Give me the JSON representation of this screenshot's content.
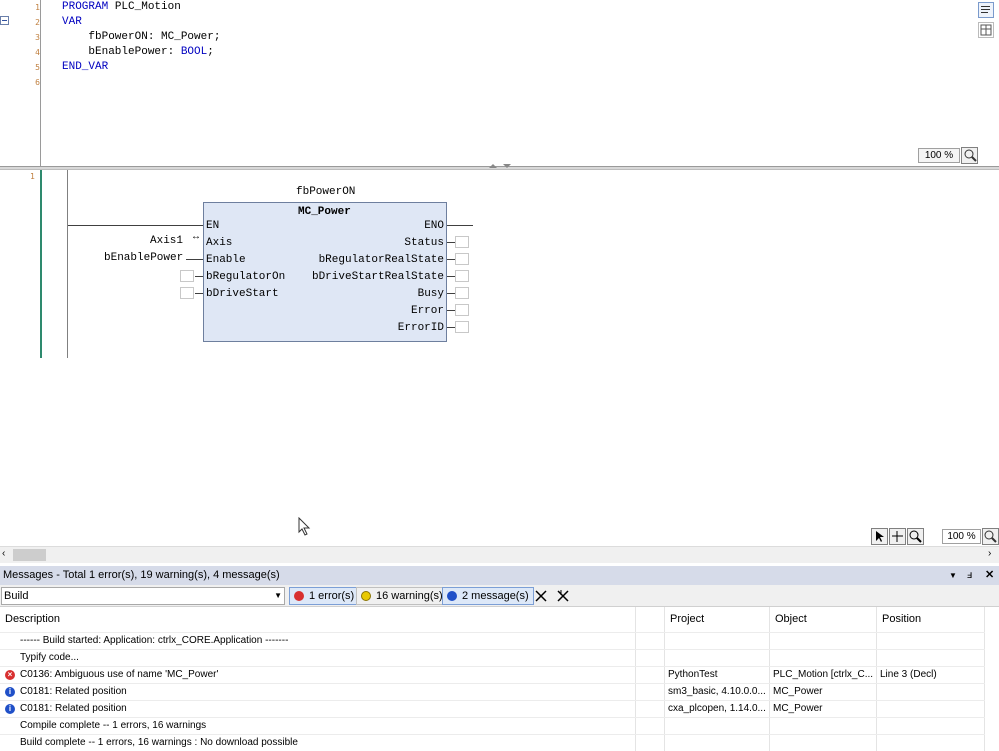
{
  "declaration": {
    "line_numbers": [
      "1",
      "2",
      "3",
      "4",
      "5",
      "6"
    ],
    "lines": [
      {
        "kw": "PROGRAM",
        "rest": " PLC_Motion"
      },
      {
        "kw": "VAR",
        "rest": ""
      },
      {
        "kw": "",
        "rest": "    fbPowerON: MC_Power;"
      },
      {
        "kw": "",
        "rest": "    bEnablePower: ",
        "kw2": "BOOL",
        "tail": ";"
      },
      {
        "kw": "END_VAR",
        "rest": ""
      },
      {
        "kw": "",
        "rest": ""
      }
    ],
    "zoom": "100 %"
  },
  "fbd": {
    "network_number": "1",
    "instance_name": "fbPowerON",
    "block_type": "MC_Power",
    "inputs": [
      "EN",
      "Axis",
      "Enable",
      "bRegulatorOn",
      "bDriveStart"
    ],
    "outputs": [
      "ENO",
      "Status",
      "bRegulatorRealState",
      "bDriveStartRealState",
      "Busy",
      "Error",
      "ErrorID"
    ],
    "input_vars": {
      "axis": "Axis1",
      "enable": "bEnablePower"
    },
    "zoom": "100 %"
  },
  "messages": {
    "title": "Messages - Total 1 error(s), 19 warning(s), 4 message(s)",
    "category": "Build",
    "filters": {
      "errors": "1 error(s)",
      "warnings": "16 warning(s)",
      "messages": "2 message(s)"
    },
    "columns": [
      "Description",
      "Project",
      "Object",
      "Position"
    ],
    "rows": [
      {
        "sev": "none",
        "desc": "------ Build started: Application: ctrlx_CORE.Application -------",
        "project": "",
        "object": "",
        "position": ""
      },
      {
        "sev": "none",
        "desc": "Typify code...",
        "project": "",
        "object": "",
        "position": ""
      },
      {
        "sev": "error",
        "desc": "C0136: Ambiguous use of name 'MC_Power'",
        "project": "PythonTest",
        "object": "PLC_Motion [ctrlx_C...",
        "position": "Line 3 (Decl)"
      },
      {
        "sev": "info",
        "desc": "C0181: Related position",
        "project": "sm3_basic, 4.10.0.0...",
        "object": "MC_Power",
        "position": ""
      },
      {
        "sev": "info",
        "desc": "C0181: Related position",
        "project": "cxa_plcopen, 1.14.0...",
        "object": "MC_Power",
        "position": ""
      },
      {
        "sev": "none",
        "desc": "Compile complete -- 1 errors, 16 warnings",
        "project": "",
        "object": "",
        "position": ""
      },
      {
        "sev": "none",
        "desc": "Build complete -- 1 errors, 16 warnings : No download possible",
        "project": "",
        "object": "",
        "position": ""
      }
    ]
  },
  "colors": {
    "error": "#d83030",
    "warning": "#e8c800",
    "info": "#2050c8",
    "block_fill": "#dfe7f5",
    "panel_title": "#d6dbe9"
  }
}
